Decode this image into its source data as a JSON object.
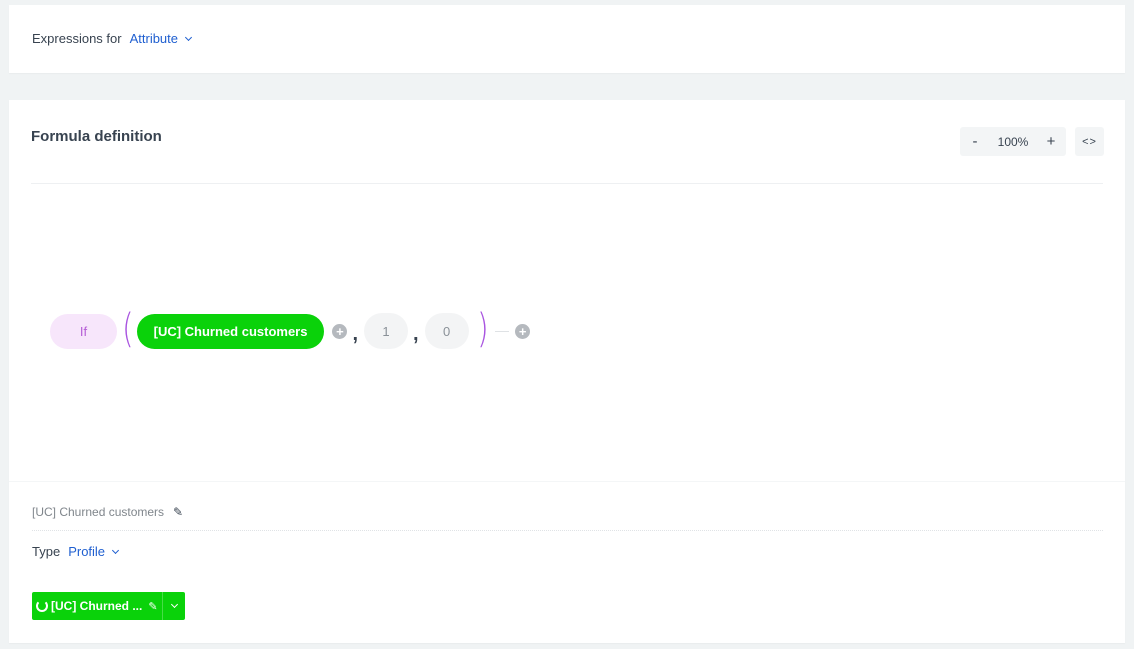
{
  "expressions": {
    "label": "Expressions for",
    "selected": "Attribute"
  },
  "formula": {
    "title": "Formula definition",
    "zoom": {
      "minus": "-",
      "level": "100%",
      "plus": "+"
    },
    "code_toggle": "<>",
    "nodes": {
      "function": "If",
      "open_paren": "(",
      "attribute": "[UC] Churned customers",
      "comma_1": ",",
      "arg_1": "1",
      "comma_2": ",",
      "arg_2": "0",
      "close_paren": ")",
      "add_symbol": "+"
    }
  },
  "details": {
    "attribute_name": "[UC] Churned customers",
    "type_label": "Type",
    "type_selected": "Profile",
    "selected_attribute_button": "[UC] Churned ...",
    "edit_icon": "✎"
  },
  "colors": {
    "accent_blue": "#1f5fd0",
    "green": "#0ad20a",
    "function_purple": "#b55ed6",
    "paren_purple": "#a955e0"
  }
}
